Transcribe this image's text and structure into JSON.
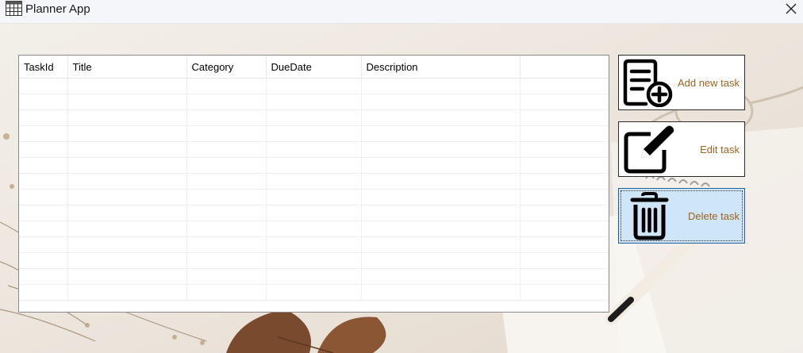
{
  "window": {
    "title": "Planner App"
  },
  "icons": {
    "app": "calendar-grid-icon",
    "close": "close-icon",
    "add": "document-add-icon",
    "edit": "edit-pencil-icon",
    "delete": "trash-icon"
  },
  "table": {
    "columns": [
      "TaskId",
      "Title",
      "Category",
      "DueDate",
      "Description",
      ""
    ],
    "empty_rows": 14
  },
  "actions": {
    "add_label": "Add new task",
    "edit_label": "Edit task",
    "delete_label": "Delete task",
    "selected": "delete"
  },
  "colors": {
    "action_text": "#a0631f",
    "selected_button": "#cfe6f8"
  }
}
